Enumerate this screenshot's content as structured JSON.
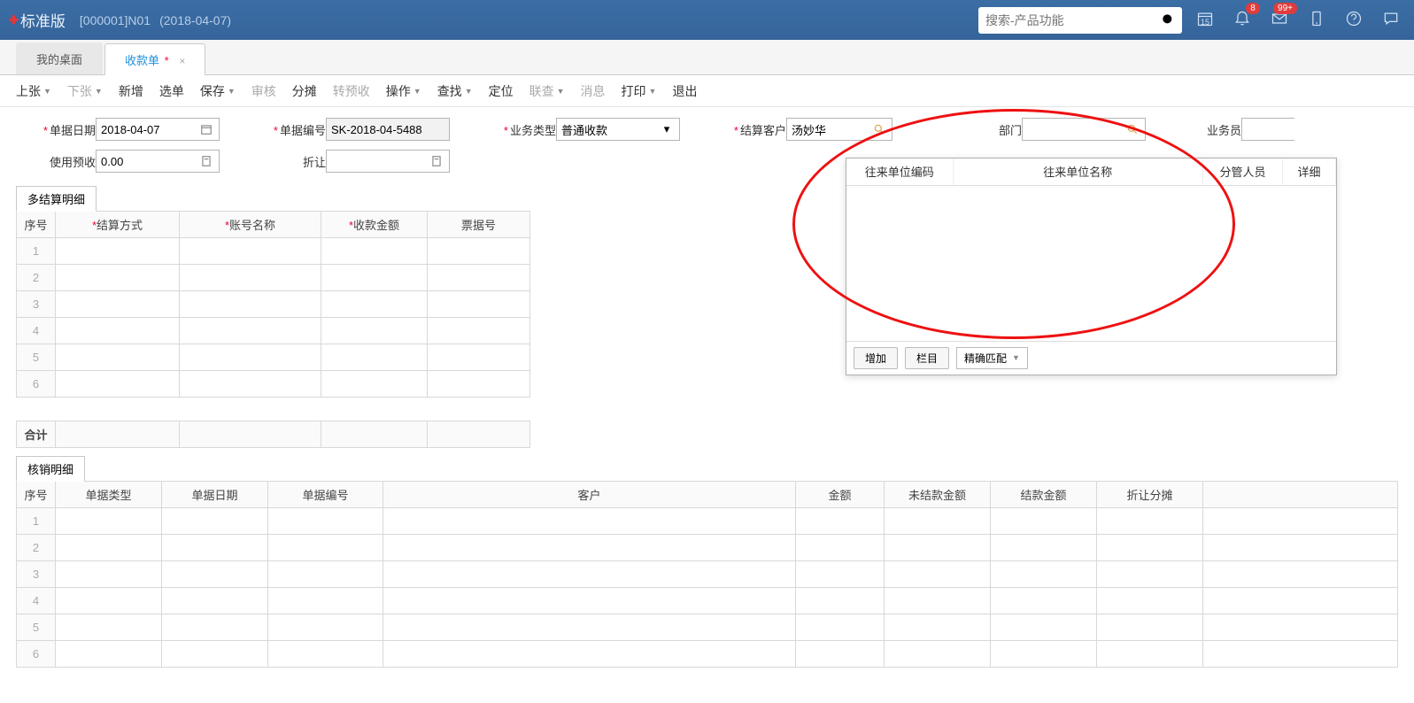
{
  "header": {
    "edition": "标准版",
    "account": "[000001]N01",
    "date": "(2018-04-07)",
    "search_placeholder": "搜索-产品功能",
    "calendar_day": "15",
    "badge_bell": "8",
    "badge_mail": "99+"
  },
  "tabs": {
    "desktop": "我的桌面",
    "receipt": "收款单",
    "close": "×"
  },
  "toolbar": {
    "prev": "上张",
    "next": "下张",
    "new": "新增",
    "select": "选单",
    "save": "保存",
    "audit": "审核",
    "allocate": "分摊",
    "to_prepay": "转预收",
    "operate": "操作",
    "find": "查找",
    "locate": "定位",
    "linked": "联查",
    "message": "消息",
    "print": "打印",
    "exit": "退出"
  },
  "form": {
    "bill_date_label": "单据日期",
    "bill_date_value": "2018-04-07",
    "bill_no_label": "单据编号",
    "bill_no_value": "SK-2018-04-5488",
    "biz_type_label": "业务类型",
    "biz_type_value": "普通收款",
    "customer_label": "结算客户",
    "customer_value": "汤妙华",
    "dept_label": "部门",
    "dept_value": "",
    "salesman_label": "业务员",
    "use_prepay_label": "使用预收",
    "use_prepay_value": "0.00",
    "discount_label": "折让",
    "discount_value": ""
  },
  "grid1": {
    "tab": "多结算明细",
    "cols": {
      "seq": "序号",
      "method": "结算方式",
      "acct": "账号名称",
      "amount": "收款金额",
      "billno": "票据号"
    },
    "sum": "合计"
  },
  "grid2": {
    "tab": "核销明细",
    "cols": {
      "seq": "序号",
      "billtype": "单据类型",
      "billdate": "单据日期",
      "billno": "单据编号",
      "customer": "客户",
      "amount": "金额",
      "unsettled": "未结款金额",
      "settled": "结款金额",
      "disc": "折让分摊"
    }
  },
  "dropdown": {
    "col_code": "往来单位编码",
    "col_name": "往来单位名称",
    "col_person": "分管人员",
    "col_detail": "详细",
    "btn_add": "增加",
    "btn_cols": "栏目",
    "match_mode": "精确匹配"
  }
}
